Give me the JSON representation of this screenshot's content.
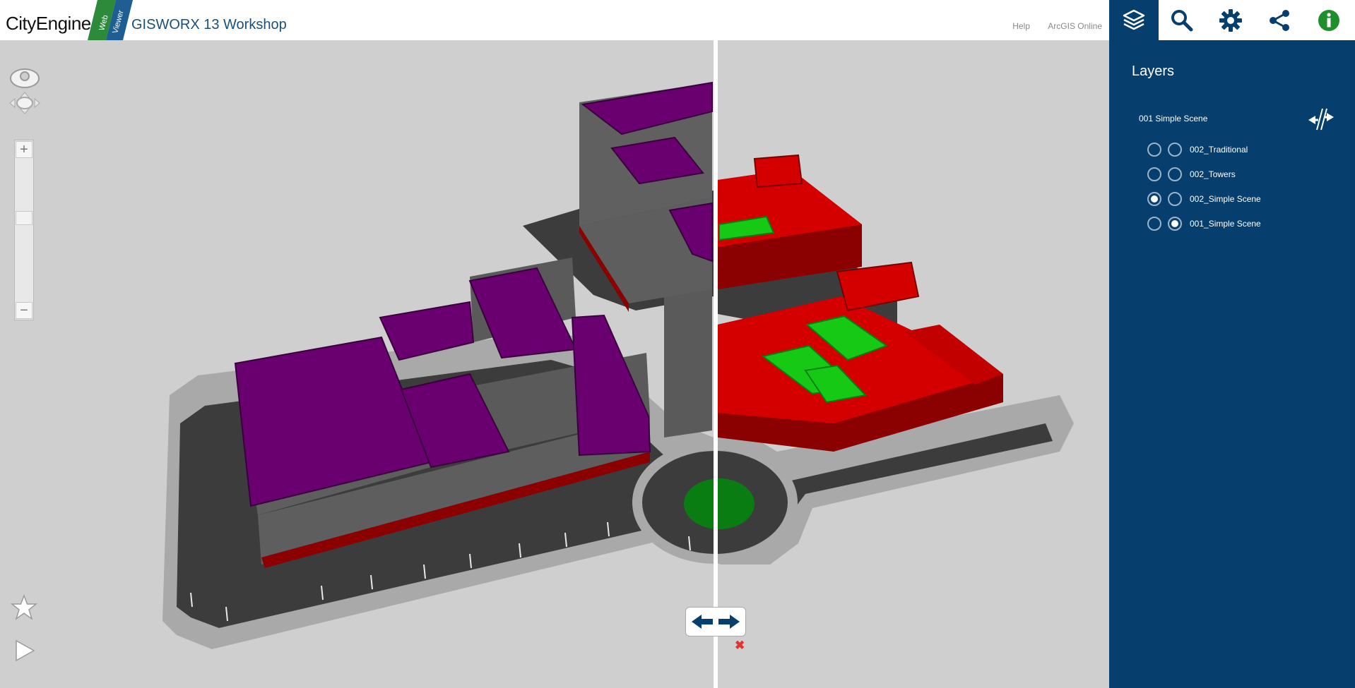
{
  "header": {
    "brand": "CityEngine",
    "badge_line1": "Web",
    "badge_line2": "Viewer",
    "title": "GISWORX 13 Workshop",
    "links": [
      "Help",
      "ArcGIS Online"
    ]
  },
  "toolbar": {
    "buttons": [
      {
        "icon": "layers-icon",
        "active": true
      },
      {
        "icon": "search-icon",
        "active": false
      },
      {
        "icon": "gear-icon",
        "active": false
      },
      {
        "icon": "share-icon",
        "active": false
      },
      {
        "icon": "info-icon",
        "active": false
      }
    ]
  },
  "panel": {
    "title": "Layers",
    "group_label": "001 Simple Scene",
    "layers": [
      {
        "label": "002_Traditional",
        "left_selected": false,
        "right_selected": false
      },
      {
        "label": "002_Towers",
        "left_selected": false,
        "right_selected": false
      },
      {
        "label": "002_Simple Scene",
        "left_selected": true,
        "right_selected": false
      },
      {
        "label": "001_Simple Scene",
        "left_selected": false,
        "right_selected": true
      }
    ]
  },
  "viewport": {
    "controls": [
      "orbit-icon",
      "pan-icon",
      "zoom-in-icon",
      "zoom-out-icon",
      "bookmark-star-icon",
      "play-icon",
      "swipe-arrows-icon",
      "close-swipe-icon"
    ]
  },
  "colors": {
    "panel": "#063f6e",
    "roof_left": "#6a006f",
    "building_gray": "#5e5e5e",
    "road": "#3c3c3c",
    "sidewalk": "#a9a9a9",
    "red": "#d40000",
    "green": "#15c915",
    "ground": "#cfcfcf"
  }
}
